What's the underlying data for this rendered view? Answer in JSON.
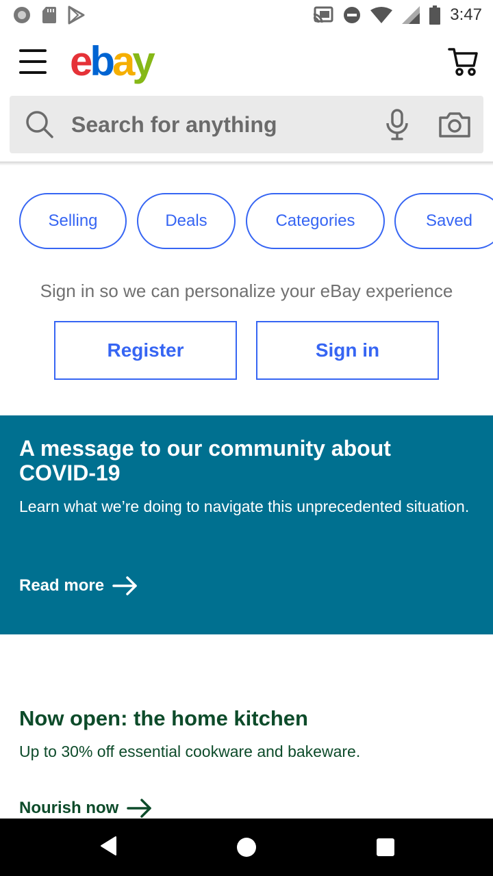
{
  "status_bar": {
    "time": "3:47",
    "left_icons": [
      "record-icon",
      "sd-card-icon",
      "play-store-icon"
    ],
    "right_icons": [
      "cast-icon",
      "do-not-disturb-icon",
      "wifi-icon",
      "signal-icon",
      "battery-icon"
    ]
  },
  "header": {
    "logo": {
      "e": "e",
      "b": "b",
      "a": "a",
      "y": "y"
    },
    "icons": [
      "menu-icon",
      "cart-icon"
    ]
  },
  "search": {
    "placeholder": "Search for anything",
    "icons": [
      "search-icon",
      "microphone-icon",
      "camera-icon"
    ]
  },
  "pills": [
    {
      "label": "Selling"
    },
    {
      "label": "Deals"
    },
    {
      "label": "Categories"
    },
    {
      "label": "Saved"
    }
  ],
  "signin": {
    "prompt": "Sign in so we can personalize your eBay experience",
    "register_label": "Register",
    "signin_label": "Sign in"
  },
  "banner": {
    "title": "A message to our community about COVID-19",
    "text": "Learn what we’re doing to navigate this unprecedented situation.",
    "link_label": "Read more",
    "background_color": "#007090"
  },
  "promo": {
    "title": "Now open: the home kitchen",
    "text": "Up to 30% off essential cookware and bakeware.",
    "link_label": "Nourish now",
    "text_color": "#0d4b2a"
  },
  "colors": {
    "accent": "#3665f3",
    "logo_red": "#e53238",
    "logo_blue": "#0064d2",
    "logo_yellow": "#f5af02",
    "logo_green": "#86b817"
  }
}
